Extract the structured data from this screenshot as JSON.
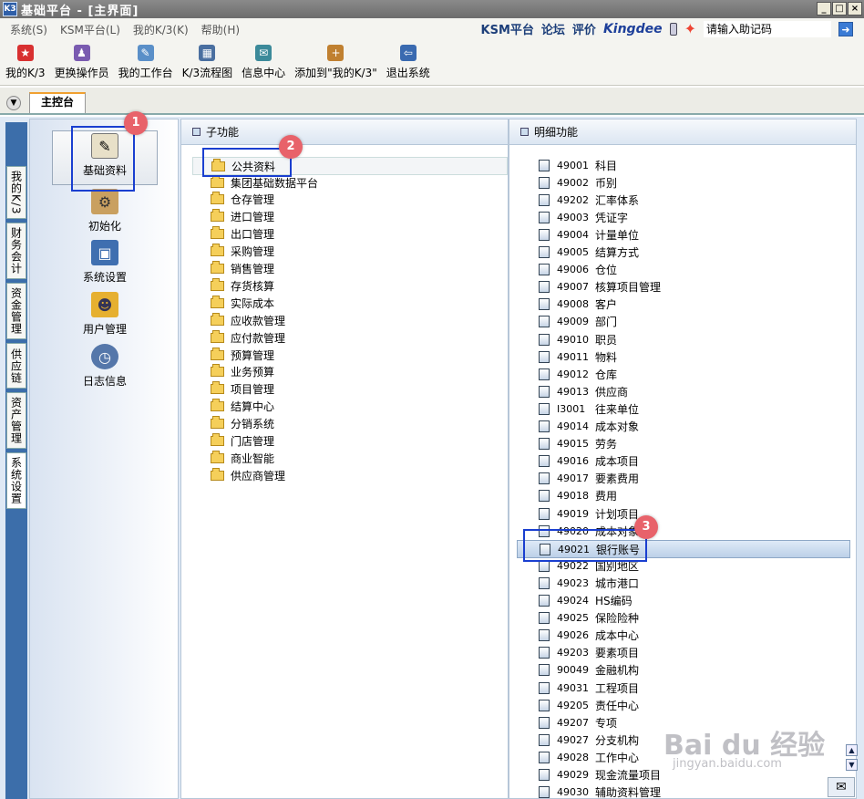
{
  "window": {
    "title": "基础平台 - [主界面]",
    "app_icon": "K3",
    "controls": [
      "_",
      "□",
      "×"
    ]
  },
  "menu": {
    "items": [
      "系统(S)",
      "KSM平台(L)",
      "我的K/3(K)",
      "帮助(H)"
    ],
    "right_links": [
      "KSM平台",
      "论坛",
      "评价"
    ],
    "brand": "Kingdee",
    "search_placeholder": "请输入助记码"
  },
  "toolbar": {
    "items": [
      {
        "label": "我的K/3",
        "icon": "star-icon",
        "color": "#d83030"
      },
      {
        "label": "更换操作员",
        "icon": "users-icon",
        "color": "#7a5bb0"
      },
      {
        "label": "我的工作台",
        "icon": "workbench-icon",
        "color": "#5a8fc8"
      },
      {
        "label": "K/3流程图",
        "icon": "flowchart-icon",
        "color": "#4a6fa0"
      },
      {
        "label": "信息中心",
        "icon": "message-icon",
        "color": "#3c8a9a"
      },
      {
        "label": "添加到\"我的K/3\"",
        "icon": "add-favorite-icon",
        "color": "#c08030"
      },
      {
        "label": "退出系统",
        "icon": "exit-icon",
        "color": "#3a6ab0"
      }
    ]
  },
  "tabs": {
    "main_tab": "主控台"
  },
  "side_tabs": [
    "我的K/3",
    "财务会计",
    "资金管理",
    "供应链",
    "资产管理",
    "系统设置"
  ],
  "categories": [
    {
      "label": "基础资料",
      "icon": "basic-data-icon"
    },
    {
      "label": "初始化",
      "icon": "initialize-icon"
    },
    {
      "label": "系统设置",
      "icon": "system-settings-icon"
    },
    {
      "label": "用户管理",
      "icon": "user-management-icon"
    },
    {
      "label": "日志信息",
      "icon": "log-icon"
    }
  ],
  "sub_panel": {
    "header": "子功能",
    "items": [
      "公共资料",
      "集团基础数据平台",
      "仓存管理",
      "进口管理",
      "出口管理",
      "采购管理",
      "销售管理",
      "存货核算",
      "实际成本",
      "应收款管理",
      "应付款管理",
      "预算管理",
      "业务预算",
      "项目管理",
      "结算中心",
      "分销系统",
      "门店管理",
      "商业智能",
      "供应商管理"
    ]
  },
  "detail_panel": {
    "header": "明细功能",
    "items": [
      {
        "code": "49001",
        "name": "科目"
      },
      {
        "code": "49002",
        "name": "币别"
      },
      {
        "code": "49202",
        "name": "汇率体系"
      },
      {
        "code": "49003",
        "name": "凭证字"
      },
      {
        "code": "49004",
        "name": "计量单位"
      },
      {
        "code": "49005",
        "name": "结算方式"
      },
      {
        "code": "49006",
        "name": "仓位"
      },
      {
        "code": "49007",
        "name": "核算项目管理"
      },
      {
        "code": "49008",
        "name": "客户"
      },
      {
        "code": "49009",
        "name": "部门"
      },
      {
        "code": "49010",
        "name": "职员"
      },
      {
        "code": "49011",
        "name": "物料"
      },
      {
        "code": "49012",
        "name": "仓库"
      },
      {
        "code": "49013",
        "name": "供应商"
      },
      {
        "code": "I3001",
        "name": "往来单位"
      },
      {
        "code": "49014",
        "name": "成本对象"
      },
      {
        "code": "49015",
        "name": "劳务"
      },
      {
        "code": "49016",
        "name": "成本项目"
      },
      {
        "code": "49017",
        "name": "要素费用"
      },
      {
        "code": "49018",
        "name": "费用"
      },
      {
        "code": "49019",
        "name": "计划项目"
      },
      {
        "code": "49020",
        "name": "成本对象组"
      },
      {
        "code": "49021",
        "name": "银行账号"
      },
      {
        "code": "49022",
        "name": "国别地区"
      },
      {
        "code": "49023",
        "name": "城市港口"
      },
      {
        "code": "49024",
        "name": "HS编码"
      },
      {
        "code": "49025",
        "name": "保险险种"
      },
      {
        "code": "49026",
        "name": "成本中心"
      },
      {
        "code": "49203",
        "name": "要素项目"
      },
      {
        "code": "90049",
        "name": "金融机构"
      },
      {
        "code": "49031",
        "name": "工程项目"
      },
      {
        "code": "49205",
        "name": "责任中心"
      },
      {
        "code": "49207",
        "name": "专项"
      },
      {
        "code": "49027",
        "name": "分支机构"
      },
      {
        "code": "49028",
        "name": "工作中心"
      },
      {
        "code": "49029",
        "name": "现金流量项目"
      },
      {
        "code": "49030",
        "name": "辅助资料管理"
      }
    ]
  },
  "annotations": [
    "1",
    "2",
    "3"
  ],
  "watermark": {
    "main": "Bai du 经验",
    "sub": "jingyan.baidu.com"
  }
}
